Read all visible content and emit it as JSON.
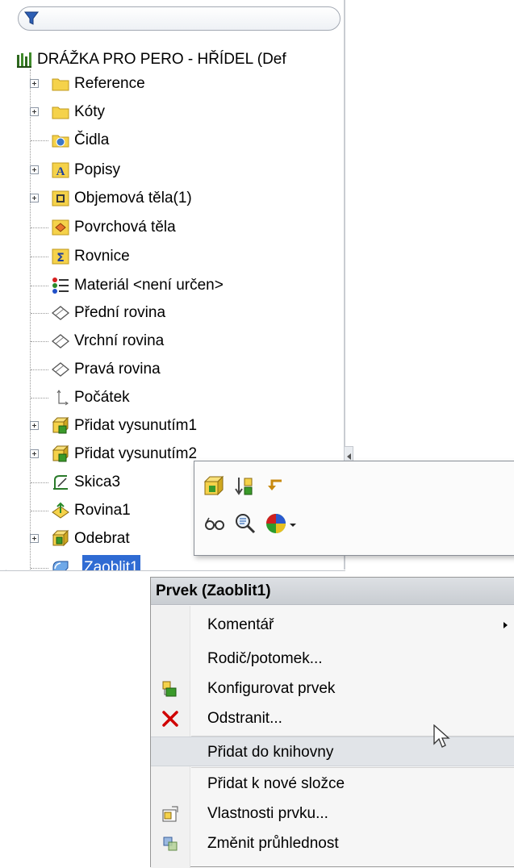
{
  "tree": {
    "root_label": "DRÁŽKA PRO PERO - HŘÍDEL  (Def",
    "items": [
      {
        "label": "Reference",
        "icon": "folder-icon",
        "expandable": true
      },
      {
        "label": "Kóty",
        "icon": "folder-icon",
        "expandable": true
      },
      {
        "label": "Čidla",
        "icon": "sensor-folder-icon",
        "expandable": false
      },
      {
        "label": "Popisy",
        "icon": "annotations-icon",
        "expandable": true
      },
      {
        "label": "Objemová těla(1)",
        "icon": "solid-bodies-icon",
        "expandable": true
      },
      {
        "label": "Povrchová těla",
        "icon": "surface-bodies-icon",
        "expandable": false
      },
      {
        "label": "Rovnice",
        "icon": "equations-icon",
        "expandable": false
      },
      {
        "label": "Materiál <není určen>",
        "icon": "material-icon",
        "expandable": false
      },
      {
        "label": "Přední rovina",
        "icon": "plane-icon",
        "expandable": false
      },
      {
        "label": "Vrchní rovina",
        "icon": "plane-icon",
        "expandable": false
      },
      {
        "label": "Pravá rovina",
        "icon": "plane-icon",
        "expandable": false
      },
      {
        "label": "Počátek",
        "icon": "origin-icon",
        "expandable": false
      },
      {
        "label": "Přidat vysunutím1",
        "icon": "boss-extrude-icon",
        "expandable": true
      },
      {
        "label": "Přidat vysunutím2",
        "icon": "boss-extrude-icon",
        "expandable": true
      },
      {
        "label": "Skica3",
        "icon": "sketch-icon",
        "expandable": false
      },
      {
        "label": "Rovina1",
        "icon": "reference-plane-icon",
        "expandable": false
      },
      {
        "label": "Odebrat",
        "icon": "cut-extrude-icon",
        "expandable": true
      },
      {
        "label": "Zaoblit1",
        "icon": "fillet-icon",
        "expandable": false,
        "selected": true
      }
    ]
  },
  "context_menu": {
    "header": "Prvek (Zaoblit1)",
    "items": [
      {
        "label": "Komentář",
        "has_submenu": true
      },
      {
        "label": "Rodič/potomek..."
      },
      {
        "label": "Konfigurovat prvek",
        "icon": "configure-feature-icon"
      },
      {
        "label": "Odstranit...",
        "icon": "delete-icon"
      },
      {
        "label": "Přidat do knihovny",
        "hover": true
      },
      {
        "label": "Přidat k nové složce"
      },
      {
        "label": "Vlastnosti prvku...",
        "icon": "feature-properties-icon"
      },
      {
        "label": "Změnit průhlednost",
        "icon": "transparency-icon"
      }
    ]
  },
  "colors": {
    "selection": "#2f6bd3",
    "menu_hover": "#e1e4e8",
    "delete_red": "#d00000",
    "folder_yellow": "#f5d24a"
  }
}
